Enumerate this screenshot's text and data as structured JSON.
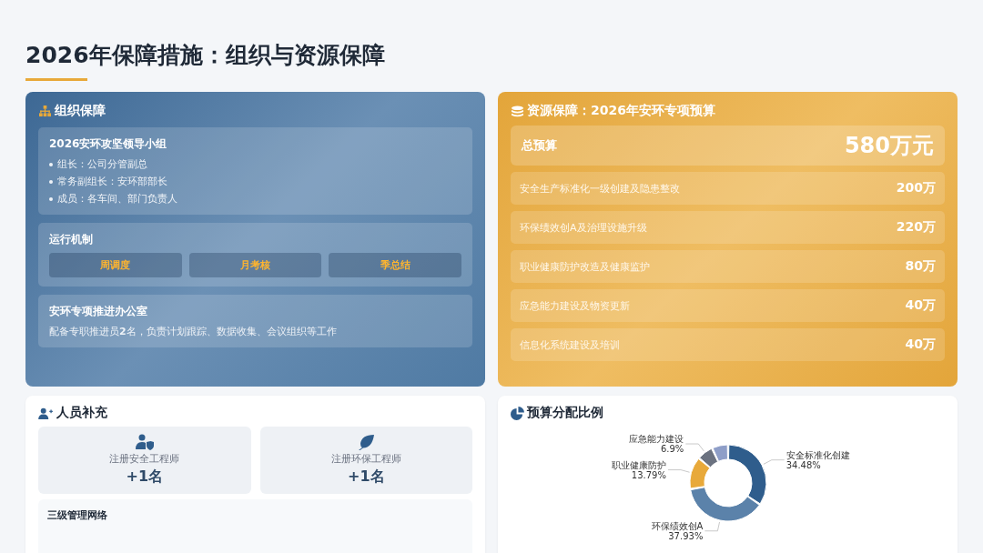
{
  "title": "2026年保障措施：组织与资源保障",
  "organization": {
    "title": "组织保障",
    "leadership": {
      "title": "2026安环攻坚领导小组",
      "items": [
        "组长：公司分管副总",
        "常务副组长：安环部部长",
        "成员：各车间、部门负责人"
      ]
    },
    "mechanism": {
      "title": "运行机制",
      "buttons": [
        "周调度",
        "月考核",
        "季总结"
      ]
    },
    "office": {
      "title": "安环专项推进办公室",
      "text": "配备专职推进员**2**名，负责计划跟踪、数据收集、会议组织等工作"
    }
  },
  "resources": {
    "title": "资源保障：2026年安环专项预算",
    "total_label": "总预算",
    "total_value": "580万元",
    "items": [
      {
        "name": "安全生产标准化一级创建及隐患整改",
        "amount": "200万"
      },
      {
        "name": "环保绩效创A及治理设施升级",
        "amount": "220万"
      },
      {
        "name": "职业健康防护改造及健康监护",
        "amount": "80万"
      },
      {
        "name": "应急能力建设及物资更新",
        "amount": "40万"
      },
      {
        "name": "信息化系统建设及培训",
        "amount": "40万"
      }
    ]
  },
  "staffing": {
    "title": "人员补充",
    "cards": [
      {
        "kind": "safety",
        "label": "注册安全工程师",
        "count": "+1名"
      },
      {
        "kind": "environment",
        "label": "注册环保工程师",
        "count": "+1名"
      }
    ],
    "network": {
      "title": "三级管理网络"
    }
  },
  "allocation": {
    "title": "预算分配比例",
    "chart_data": {
      "type": "donut",
      "categories": [
        "安全标准化创建",
        "环保绩效创A",
        "职业健康防护",
        "应急能力建设",
        null
      ],
      "values": [
        34.48,
        37.93,
        13.79,
        6.9,
        6.9
      ],
      "colors": [
        "#2f5d8c",
        "#5b82aa",
        "#e8a93a",
        "#6b7280",
        "#8e9ec8"
      ],
      "value_labels": [
        "34.48%",
        "37.93%",
        "13.79%",
        "6.9%",
        null
      ]
    }
  }
}
